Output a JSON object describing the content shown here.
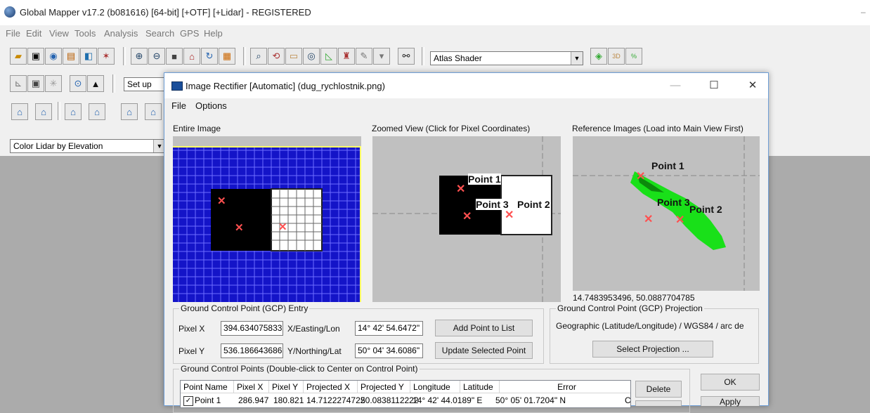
{
  "app": {
    "title": "Global Mapper v17.2 (b081616) [64-bit] [+OTF] [+Lidar] - REGISTERED",
    "menu": [
      "File",
      "Edit",
      "View",
      "Tools",
      "Analysis",
      "Search",
      "GPS",
      "Help"
    ]
  },
  "toolbar": {
    "shader_select": "Atlas Shader",
    "setup_select": "Set up",
    "lidar_color_select": "Color Lidar by Elevation"
  },
  "dialog": {
    "title": "Image Rectifier [Automatic] (dug_rychlostnik.png)",
    "menu": [
      "File",
      "Options"
    ],
    "panels": {
      "entire_image": "Entire Image",
      "zoomed_view": "Zoomed View (Click for Pixel Coordinates)",
      "reference_images": "Reference Images (Load into Main View First)"
    },
    "reference_coords": "14.7483953496, 50.0887704785",
    "points": {
      "p1": "Point 1",
      "p2": "Point 2",
      "p3": "Point 3"
    },
    "gcp_entry": {
      "legend": "Ground Control Point (GCP) Entry",
      "pixel_x_label": "Pixel X",
      "pixel_x_value": "394.634075833!",
      "pixel_y_label": "Pixel Y",
      "pixel_y_value": "536.186643686(",
      "easting_label": "X/Easting/Lon",
      "easting_value": "14° 42' 54.6472\"",
      "northing_label": "Y/Northing/Lat",
      "northing_value": "50° 04' 34.6086\"",
      "add_button": "Add Point to List",
      "update_button": "Update Selected Point"
    },
    "gcp_projection": {
      "legend": "Ground Control Point (GCP) Projection",
      "value": "Geographic (Latitude/Longitude) / WGS84 / arc de",
      "select_button": "Select Projection ..."
    },
    "gcp_list": {
      "legend": "Ground Control Points (Double-click to Center on Control Point)",
      "columns": [
        "Point Name",
        "Pixel X",
        "Pixel Y",
        "Projected X",
        "Projected Y",
        "Longitude",
        "Latitude",
        "Error"
      ],
      "row": [
        "Point 1",
        "286.947",
        "180.821",
        "14.7122274722",
        "50.0838112222",
        "14° 42' 44.0189\" E",
        "50° 05' 01.7204\" N",
        "C"
      ]
    },
    "buttons": {
      "delete": "Delete",
      "ok": "OK",
      "apply": "Apply"
    }
  }
}
